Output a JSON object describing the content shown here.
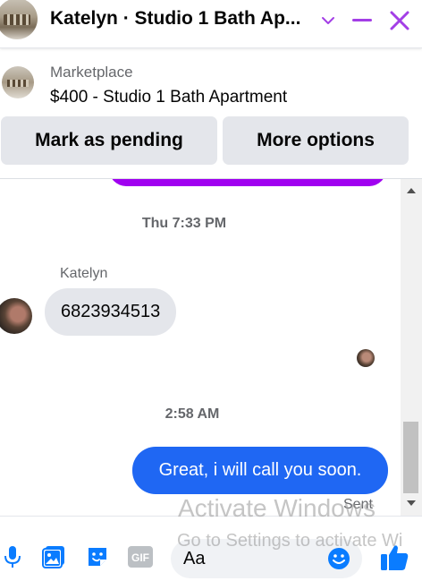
{
  "header": {
    "title": "Katelyn · Studio 1 Bath Ap...",
    "accent_color": "#a33ee6"
  },
  "marketplace": {
    "label": "Marketplace",
    "listing_title": "$400 - Studio 1 Bath Apartment",
    "mark_pending_label": "Mark as pending",
    "more_options_label": "More options"
  },
  "conversation": {
    "timestamp_1": "Thu 7:33 PM",
    "sender_name": "Katelyn",
    "incoming_message": "6823934513",
    "timestamp_2": "2:58 AM",
    "outgoing_message": "Great, i will call you soon.",
    "outgoing_status": "Sent",
    "outgoing_color": "#1f67f3",
    "previous_bubble_color": "#a000f0"
  },
  "composer": {
    "placeholder": "Aa",
    "icons": [
      "microphone-icon",
      "photo-icon",
      "sticker-icon",
      "gif-icon",
      "emoji-icon",
      "thumbs-up-icon"
    ],
    "accent_color": "#0a7cff"
  },
  "watermark": {
    "line1": "Activate Windows",
    "line2": "Go to Settings to activate Wi"
  }
}
